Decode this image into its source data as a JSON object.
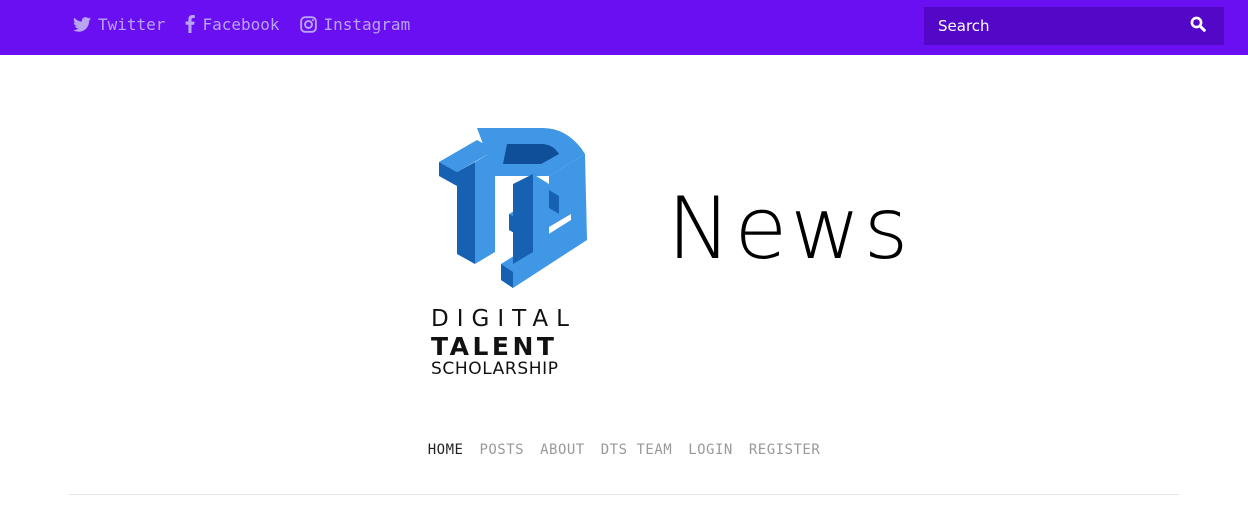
{
  "colors": {
    "topbar": "#6a0ff2",
    "search_bg": "#5308c7",
    "social_text": "#b9a4f3",
    "logo_blue": "#3f97e6",
    "logo_dark_blue": "#1761b3"
  },
  "topbar": {
    "social": [
      {
        "label": "Twitter",
        "icon": "twitter-icon"
      },
      {
        "label": "Facebook",
        "icon": "facebook-icon"
      },
      {
        "label": "Instagram",
        "icon": "instagram-icon"
      }
    ],
    "search": {
      "placeholder": "Search",
      "icon": "search-icon"
    }
  },
  "brand": {
    "logo_line1": "DIGITAL",
    "logo_line2": "TALENT",
    "logo_line3": "SCHOLARSHIP",
    "wordmark": "News"
  },
  "nav": {
    "items": [
      {
        "label": "HOME",
        "active": true
      },
      {
        "label": "POSTS",
        "active": false
      },
      {
        "label": "ABOUT",
        "active": false
      },
      {
        "label": "DTS TEAM",
        "active": false
      },
      {
        "label": "LOGIN",
        "active": false
      },
      {
        "label": "REGISTER",
        "active": false
      }
    ]
  }
}
